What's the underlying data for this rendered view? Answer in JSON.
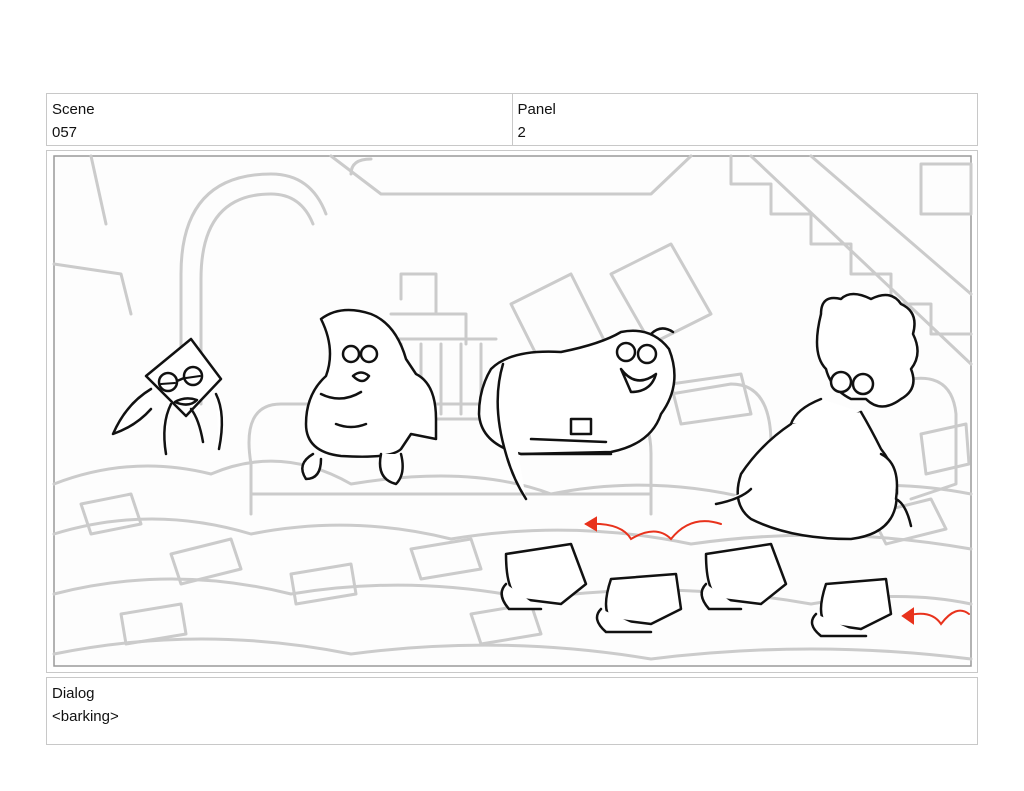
{
  "header": {
    "scene_label": "Scene",
    "scene_value": "057",
    "panel_label": "Panel",
    "panel_value": "2"
  },
  "dialog": {
    "label": "Dialog",
    "text": "<barking>"
  },
  "colors": {
    "border": "#c8c8c8",
    "background_sketch": "#c9c9c9",
    "ink": "#111111",
    "motion_arrow": "#e8321c"
  },
  "illustration": {
    "characters": [
      "squid",
      "starfish",
      "grandpa",
      "grandma",
      "dogs"
    ]
  }
}
